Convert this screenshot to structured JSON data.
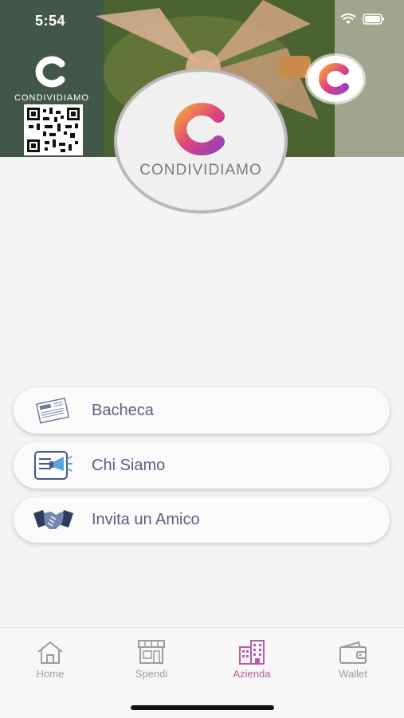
{
  "status": {
    "time": "5:54"
  },
  "brand": {
    "name": "CONDIVIDIAMO",
    "small_name": "CONDIVIDIAMO"
  },
  "menu": [
    {
      "label": "Bacheca",
      "icon": "newspaper-icon"
    },
    {
      "label": "Chi Siamo",
      "icon": "megaphone-icon"
    },
    {
      "label": "Invita un Amico",
      "icon": "handshake-icon"
    }
  ],
  "tabs": [
    {
      "label": "Home",
      "icon": "home-icon",
      "active": false
    },
    {
      "label": "Spendi",
      "icon": "shop-icon",
      "active": false
    },
    {
      "label": "Azienda",
      "icon": "building-icon",
      "active": true
    },
    {
      "label": "Wallet",
      "icon": "wallet-icon",
      "active": false
    }
  ],
  "colors": {
    "accent": "#b25da6",
    "gradient_start": "#f2a23a",
    "gradient_end": "#9a3fb9",
    "menu_text": "#5a5f7e"
  }
}
